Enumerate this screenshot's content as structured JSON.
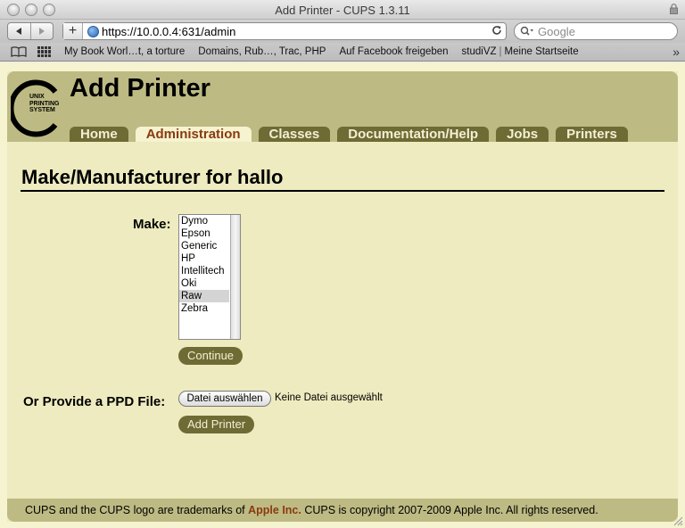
{
  "browser": {
    "window_title": "Add Printer - CUPS 1.3.11",
    "url": "https://10.0.0.4:631/admin",
    "search_placeholder": "Google",
    "bookmarks": [
      "My Book Worl…t, a torture",
      "Domains, Rub…, Trac, PHP",
      "Auf Facebook freigeben",
      "studiVZ",
      "Meine Startseite"
    ],
    "bookmark_separator": "|"
  },
  "header": {
    "logo_text": [
      "UNIX",
      "PRINTING",
      "SYSTEM"
    ],
    "title": "Add Printer",
    "tabs": [
      {
        "label": "Home",
        "active": false
      },
      {
        "label": "Administration",
        "active": true
      },
      {
        "label": "Classes",
        "active": false
      },
      {
        "label": "Documentation/Help",
        "active": false
      },
      {
        "label": "Jobs",
        "active": false
      },
      {
        "label": "Printers",
        "active": false
      }
    ]
  },
  "main": {
    "section_title": "Make/Manufacturer for hallo",
    "make_label": "Make:",
    "make_options": [
      "Dymo",
      "Epson",
      "Generic",
      "HP",
      "Intellitech",
      "Oki",
      "Raw",
      "Zebra"
    ],
    "make_selected": "Raw",
    "continue_label": "Continue",
    "ppd_label": "Or Provide a PPD File:",
    "file_button_label": "Datei auswählen",
    "file_status": "Keine Datei ausgewählt",
    "add_printer_label": "Add Printer"
  },
  "footer": {
    "text_before": "CUPS and the CUPS logo are trademarks of ",
    "apple_link": "Apple Inc.",
    "text_after": " CUPS is copyright 2007-2009 Apple Inc. All rights reserved."
  },
  "colors": {
    "header_band": "#bdbb83",
    "tab_bg": "#6f6b35",
    "tab_active_text": "#8a3a10",
    "page_bg": "#edebbf"
  }
}
